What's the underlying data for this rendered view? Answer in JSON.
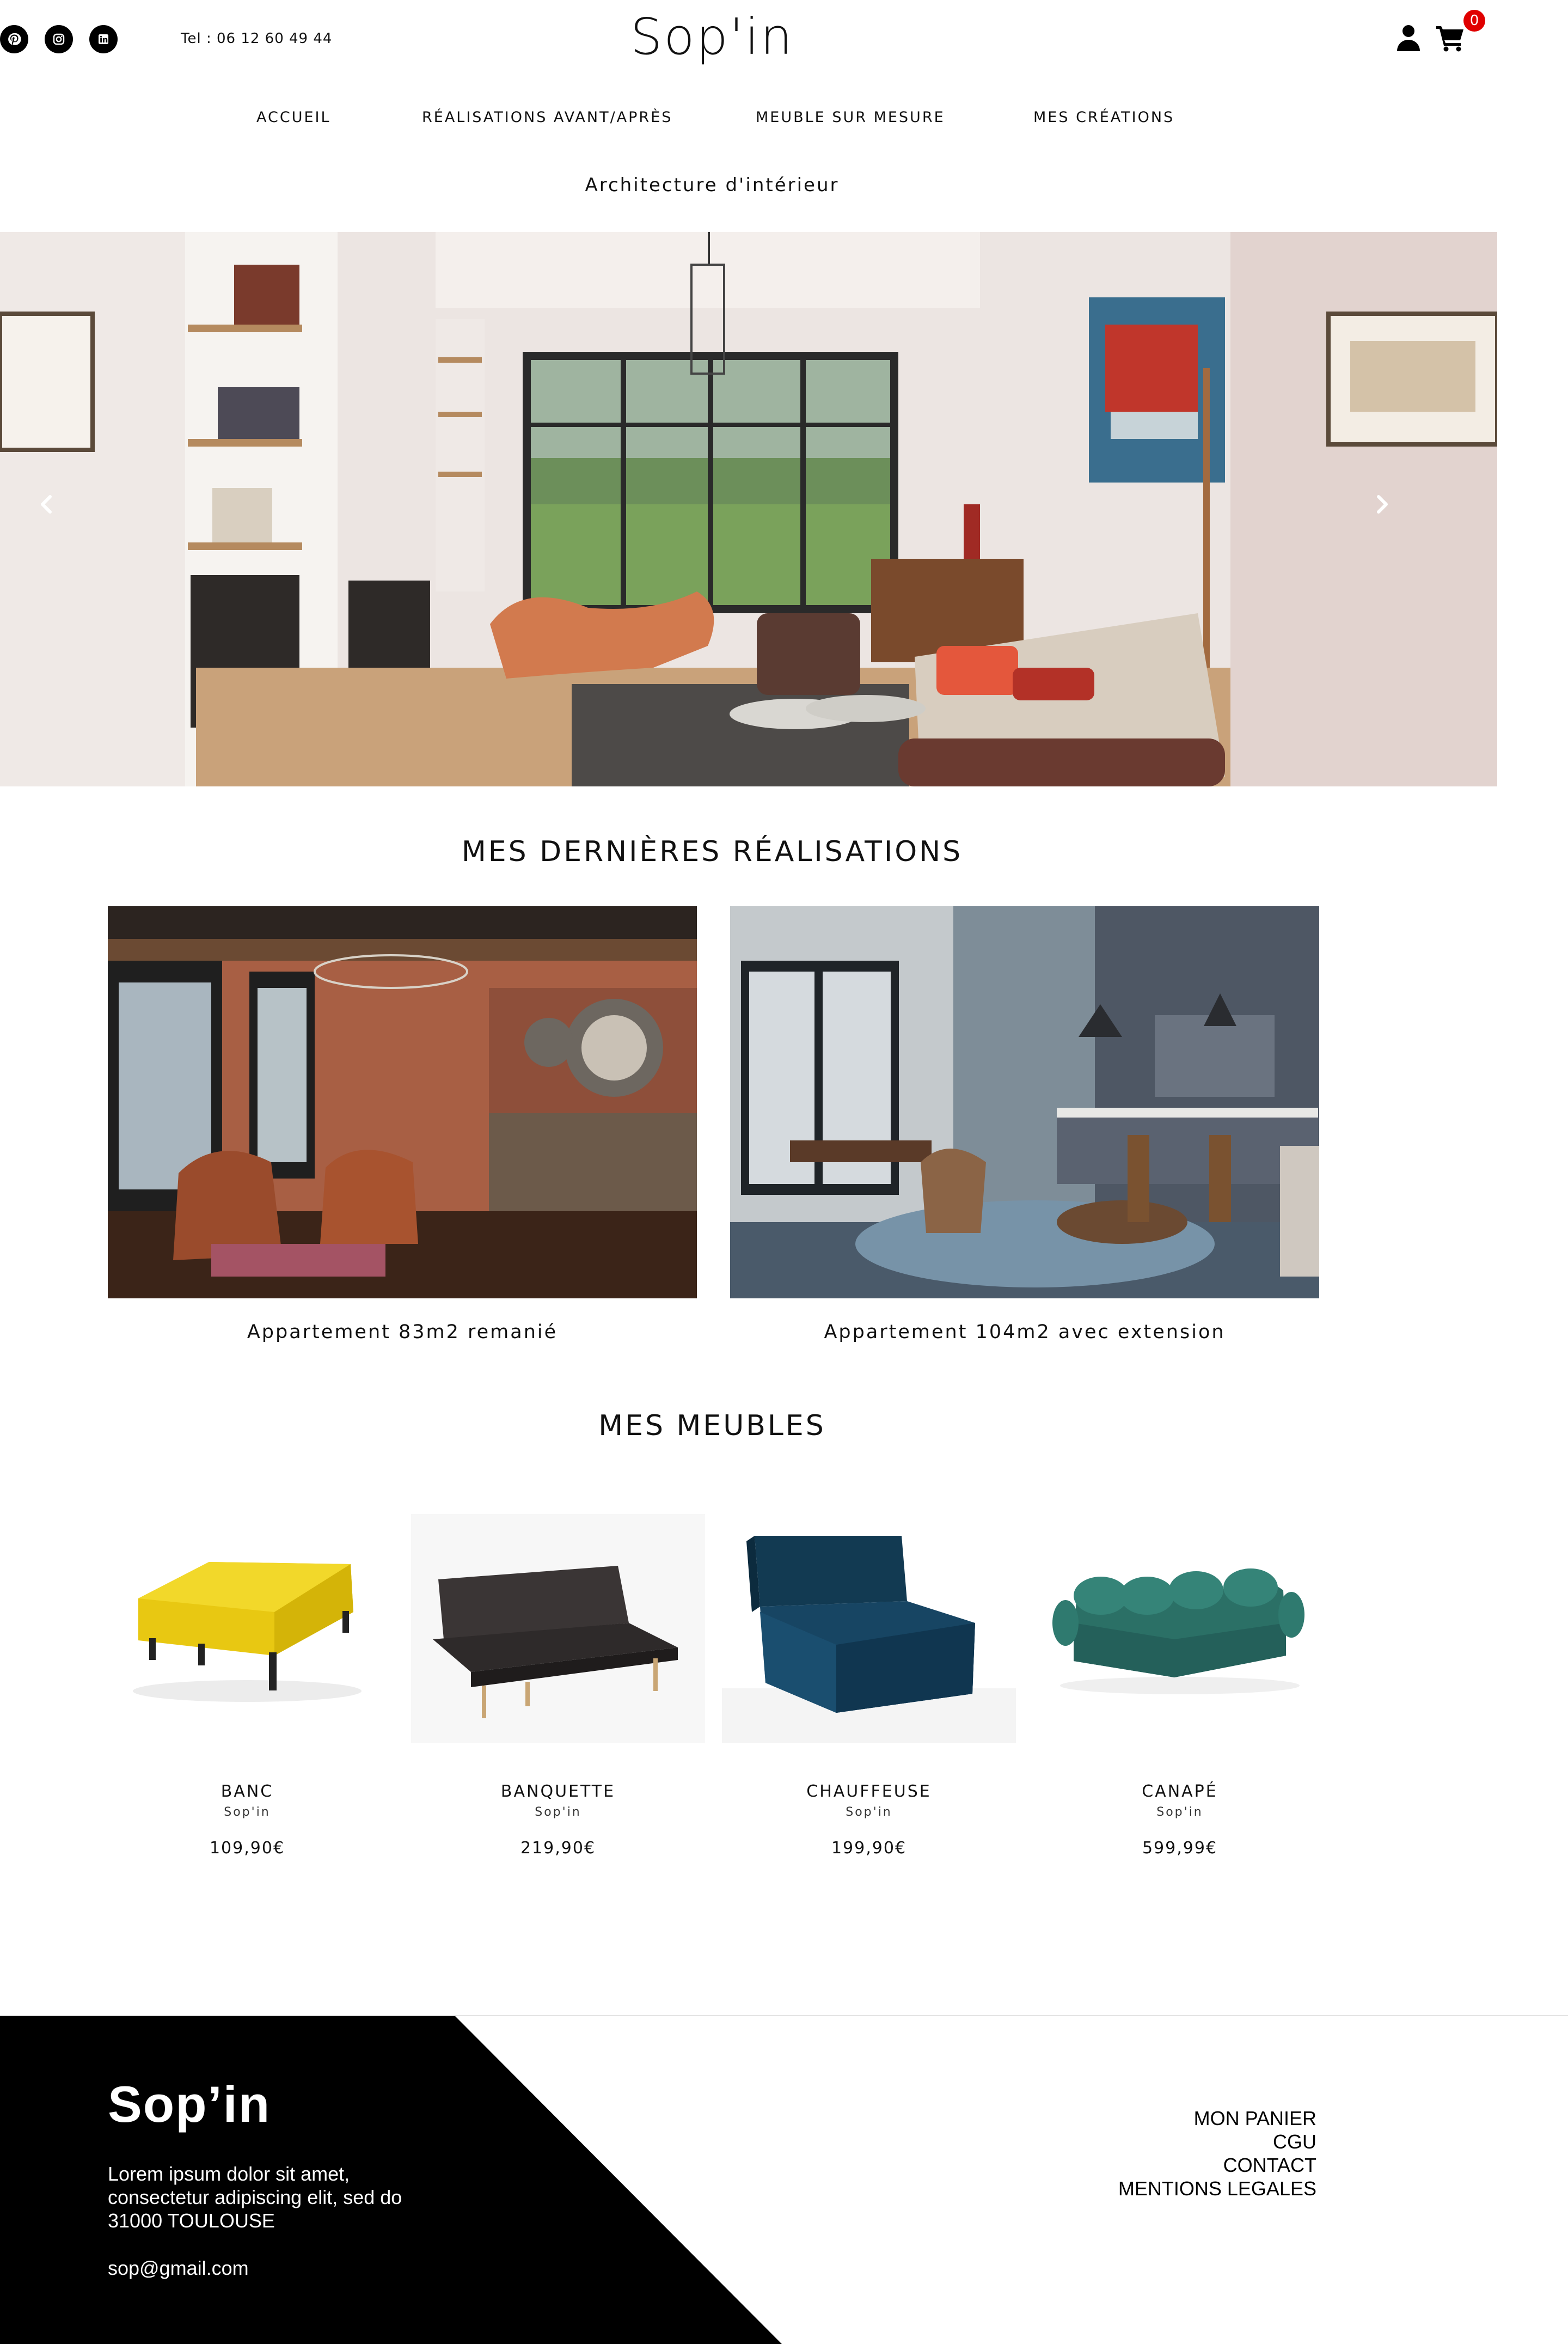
{
  "header": {
    "phone": "Tel : 06 12 60 49 44",
    "logo": "Sop'in",
    "cart_count": "0",
    "social_icons": [
      "pinterest-icon",
      "instagram-icon",
      "linkedin-icon"
    ]
  },
  "nav": {
    "items": [
      "ACCUEIL",
      "RÉALISATIONS AVANT/APRÈS",
      "MEUBLE SUR MESURE",
      "MES CRÉATIONS"
    ],
    "sub_item": "Architecture d'intérieur"
  },
  "sections": {
    "realisations_title": "MES DERNIÈRES RÉALISATIONS",
    "meubles_title": "MES MEUBLES"
  },
  "realisations": [
    {
      "caption": "Appartement 83m2 remanié"
    },
    {
      "caption": "Appartement 104m2 avec extension"
    }
  ],
  "products": [
    {
      "name": "BANC",
      "brand": "Sop'in",
      "price": "109,90€",
      "color": "#e8c812"
    },
    {
      "name": "BANQUETTE",
      "brand": "Sop'in",
      "price": "219,90€",
      "color": "#3a3535"
    },
    {
      "name": "CHAUFFEUSE",
      "brand": "Sop'in",
      "price": "199,90€",
      "color": "#123a52"
    },
    {
      "name": "CANAPÉ",
      "brand": "Sop'in",
      "price": "599,99€",
      "color": "#2b7066"
    }
  ],
  "footer": {
    "title": "Sop’in",
    "text_line_1": "Lorem ipsum dolor sit amet,",
    "text_line_2": "consectetur adipiscing elit, sed do",
    "text_line_3": "31000 TOULOUSE",
    "email": "sop@gmail.com",
    "links": [
      "MON PANIER",
      "CGU",
      "CONTACT",
      "MENTIONS LEGALES"
    ]
  },
  "colors": {
    "accent_badge": "#e00000",
    "footer_black": "#000000"
  }
}
